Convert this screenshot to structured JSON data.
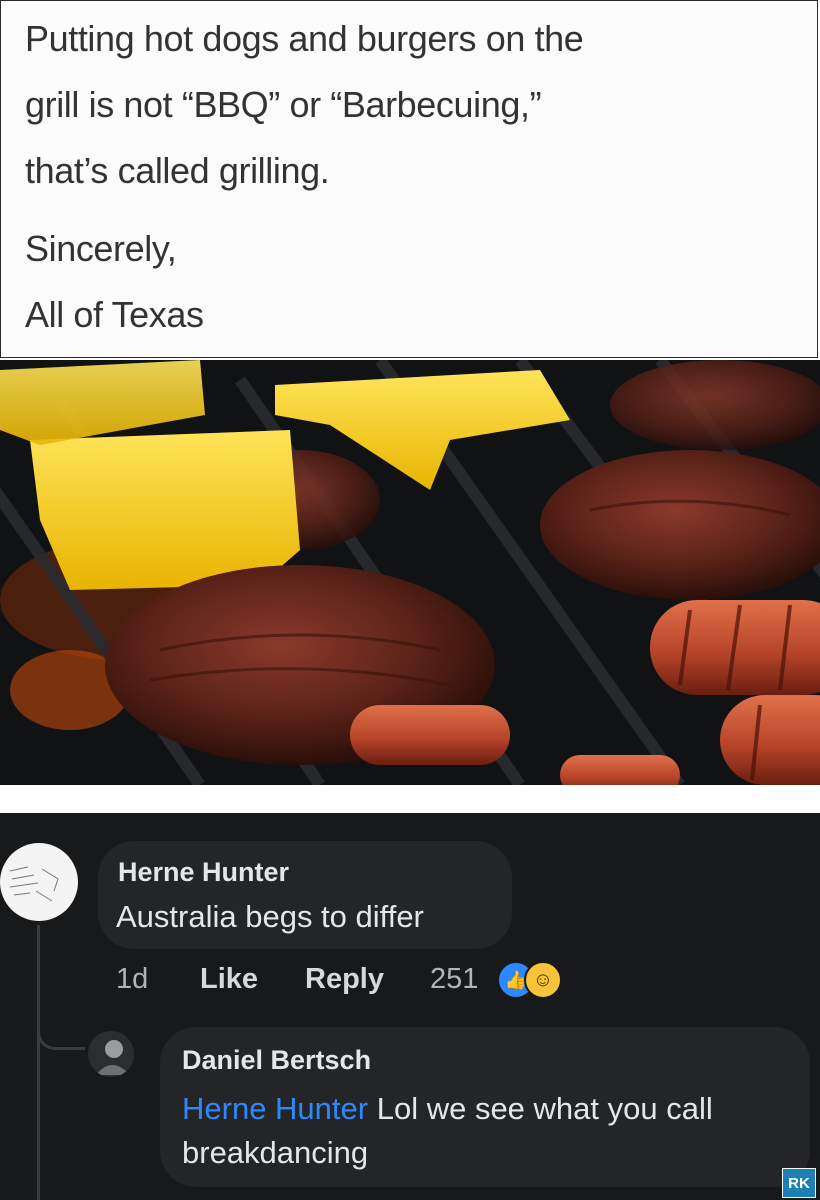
{
  "tweet": {
    "lines": [
      "Putting hot dogs and burgers on the",
      "grill is not “BBQ” or “Barbecuing,”",
      "that’s called grilling.",
      "Sincerely,",
      "All of Texas"
    ]
  },
  "photo": {
    "subject": "burger patties with cheese and hot dogs on a grill"
  },
  "comments": [
    {
      "author": "Herne Hunter",
      "text": "Australia begs to differ",
      "time": "1d",
      "like_label": "Like",
      "reply_label": "Reply",
      "reaction_count": "251",
      "reactions": [
        "like-icon",
        "haha-icon"
      ]
    },
    {
      "author": "Daniel Bertsch",
      "mention": "Herne Hunter",
      "text": "Lol we see what you call breakdancing"
    }
  ],
  "watermark": {
    "text": "RK"
  },
  "colors": {
    "comment_bg": "#18191a",
    "bubble_bg": "#242526",
    "mention": "#2d88ff",
    "like_reaction": "#2d88ff",
    "haha_reaction": "#f7c338"
  }
}
